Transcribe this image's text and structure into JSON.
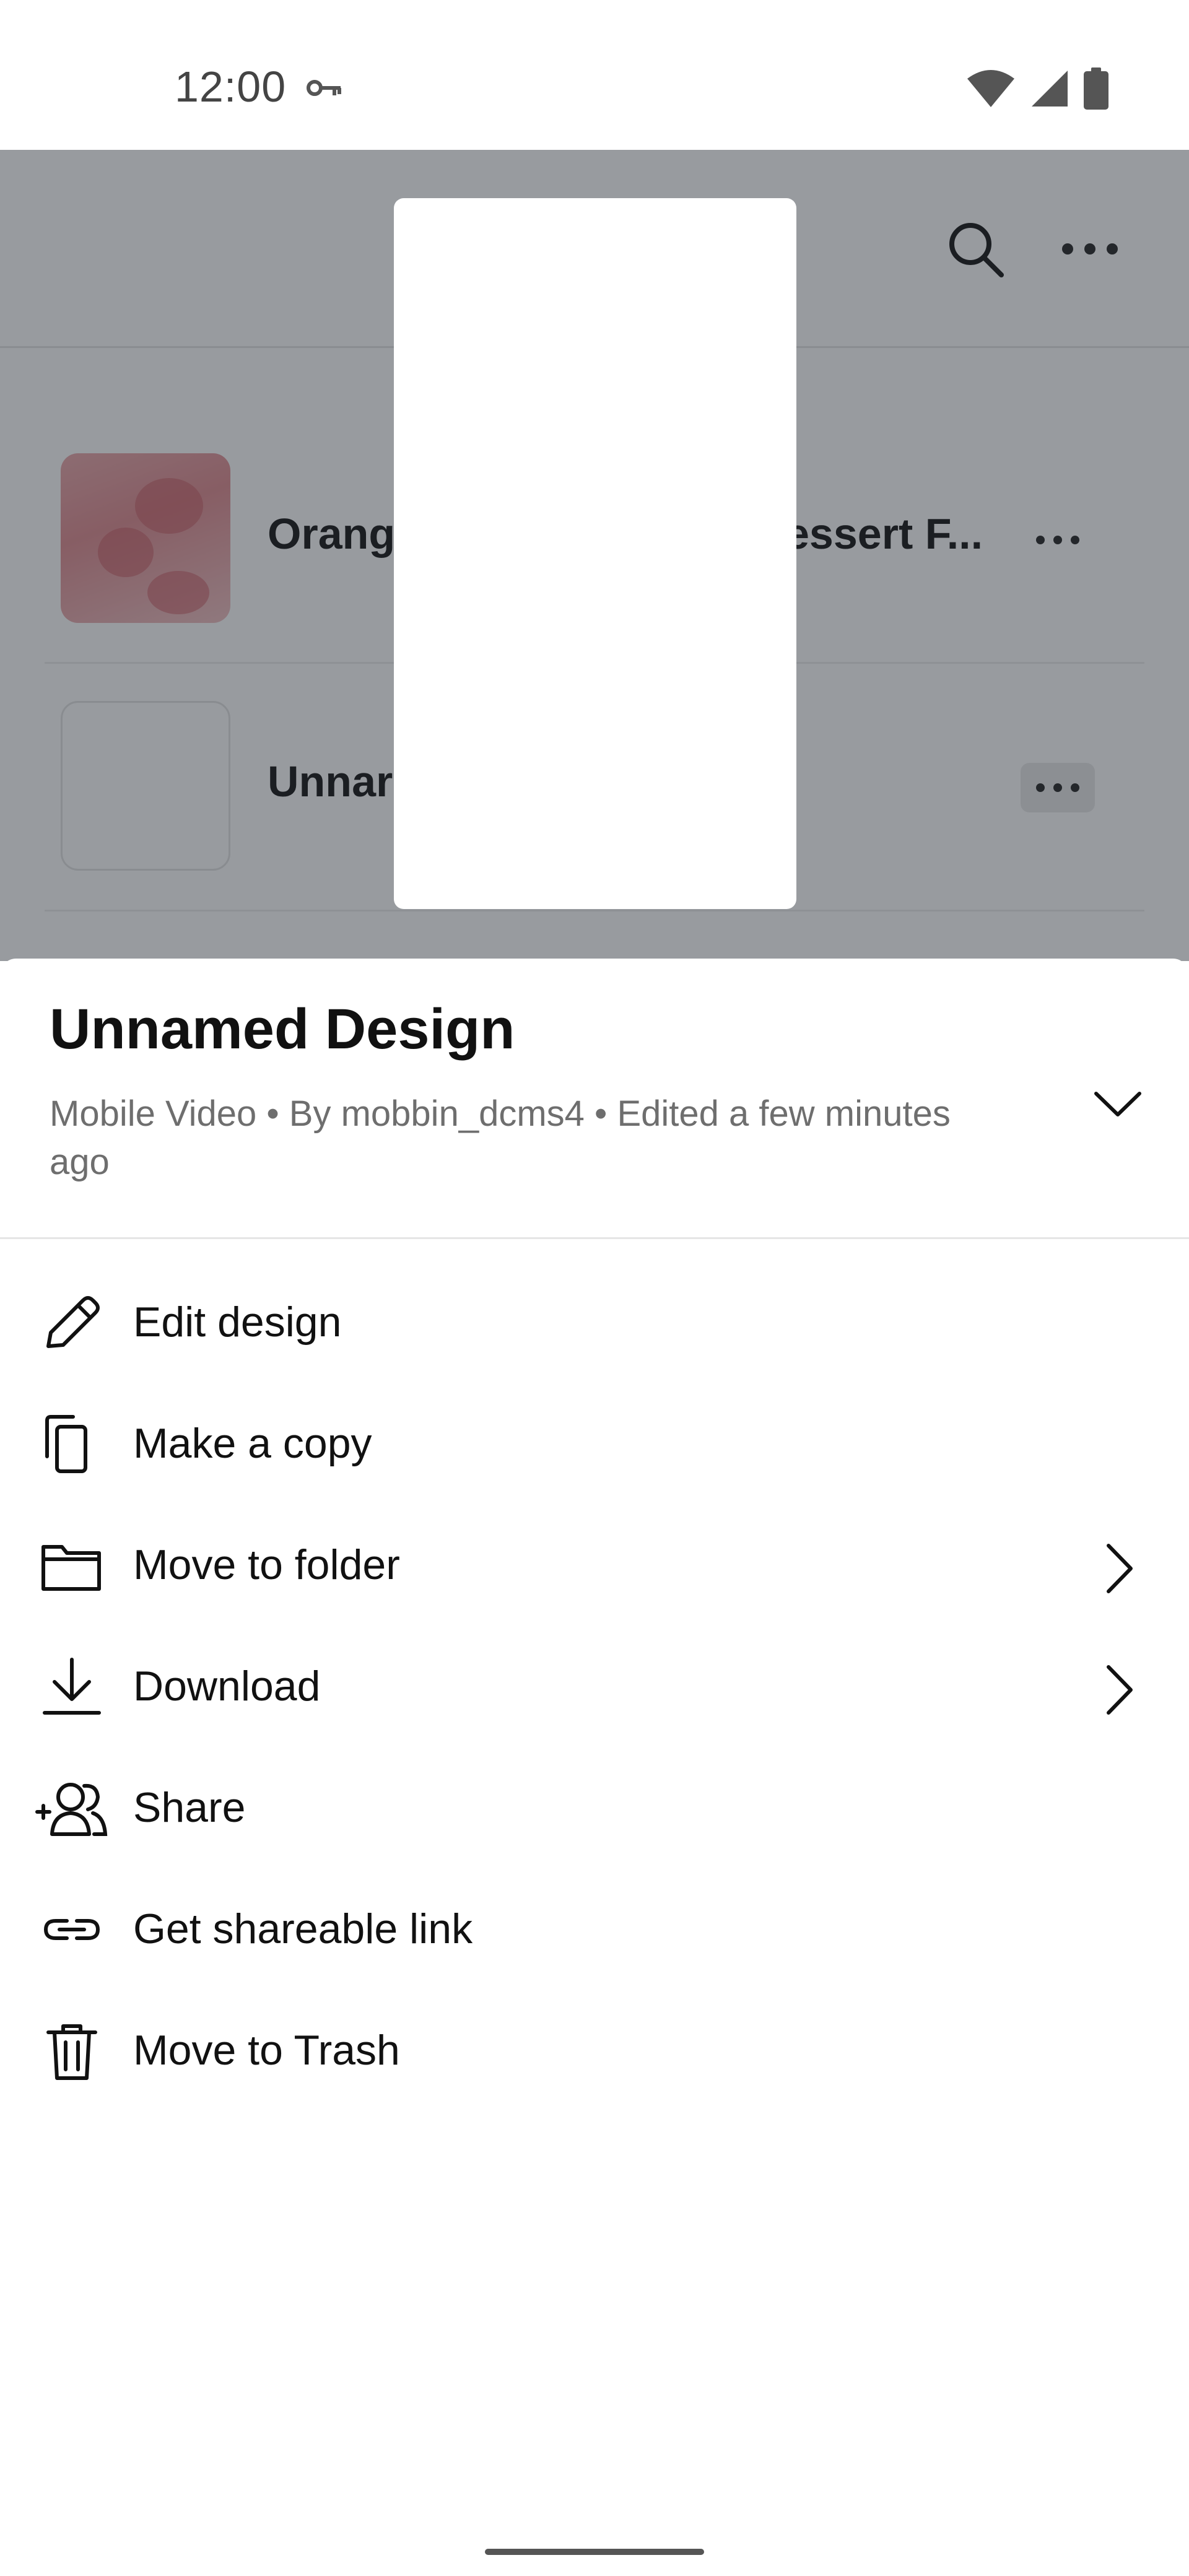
{
  "status_bar": {
    "time": "12:00"
  },
  "background_list": {
    "items": [
      {
        "title": "Orang",
        "title_tail": "essert F..."
      },
      {
        "title": "Unnar",
        "title_tail": ""
      }
    ]
  },
  "sheet": {
    "title": "Unnamed Design",
    "subtitle": "Mobile Video • By mobbin_dcms4 • Edited a few minutes ago"
  },
  "menu": {
    "items": [
      {
        "label": "Edit design",
        "icon": "pencil-icon",
        "has_arrow": false
      },
      {
        "label": "Make a copy",
        "icon": "copy-icon",
        "has_arrow": false
      },
      {
        "label": "Move to folder",
        "icon": "folder-icon",
        "has_arrow": true
      },
      {
        "label": "Download",
        "icon": "download-icon",
        "has_arrow": true
      },
      {
        "label": "Share",
        "icon": "add-person-icon",
        "has_arrow": false
      },
      {
        "label": "Get shareable link",
        "icon": "link-icon",
        "has_arrow": false
      },
      {
        "label": "Move to Trash",
        "icon": "trash-icon",
        "has_arrow": false
      }
    ]
  },
  "colors": {
    "scrim": "#282d37",
    "text_primary": "#111111",
    "text_secondary": "#6e6e6e",
    "divider": "#e6e6e6"
  }
}
